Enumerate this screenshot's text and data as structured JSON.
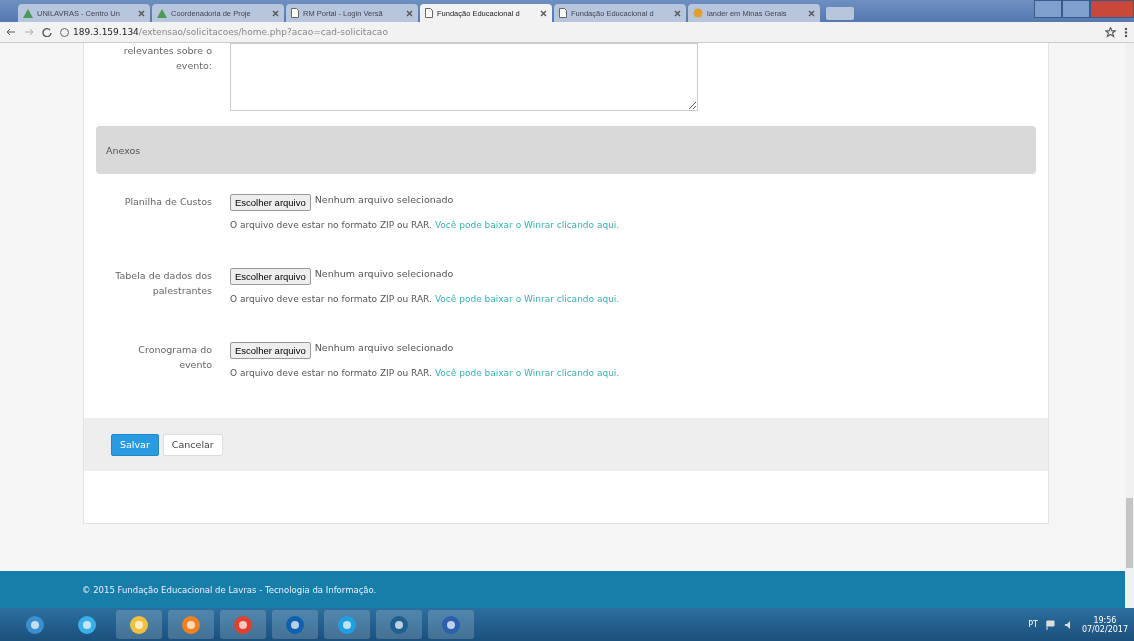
{
  "browser": {
    "tabs": [
      {
        "label": "UNILAVRAS - Centro Un",
        "selected": false
      },
      {
        "label": "Coordenadoria de Proje",
        "selected": false
      },
      {
        "label": "RM Portal - Login Versã",
        "selected": false
      },
      {
        "label": "Fundação Educacional d",
        "selected": true
      },
      {
        "label": "Fundação Educacional d",
        "selected": false
      },
      {
        "label": "lander em Minas Gerais",
        "selected": false
      }
    ],
    "address": {
      "host": "189.3.159.134",
      "path": "/extensao/solicitacoes/home.php?acao=cad-solicitacao"
    }
  },
  "form": {
    "textarea_label": "relevantes sobre o evento:",
    "section_title": "Anexos",
    "attachments": [
      {
        "label": "Planilha de Custos",
        "button": "Escolher arquivo",
        "status": "Nenhum arquivo selecionado",
        "hint": "O arquivo deve estar no formato ZIP ou RAR.",
        "link": "Você pode baixar o Winrar clicando aqui."
      },
      {
        "label": "Tabela de dados dos palestrantes",
        "button": "Escolher arquivo",
        "status": "Nenhum arquivo selecionado",
        "hint": "O arquivo deve estar no formato ZIP ou RAR.",
        "link": "Você pode baixar o Winrar clicando aqui."
      },
      {
        "label": "Cronograma do evento",
        "button": "Escolher arquivo",
        "status": "Nenhum arquivo selecionado",
        "hint": "O arquivo deve estar no formato ZIP ou RAR.",
        "link": "Você pode baixar o Winrar clicando aqui."
      }
    ],
    "buttons": [
      {
        "label": "Salvar",
        "kind": "primary"
      },
      {
        "label": "Cancelar",
        "kind": "default"
      }
    ]
  },
  "footer": "© 2015 Fundação Educacional de Lavras - Tecnologia da Informação.",
  "taskbar": {
    "language": "PT",
    "time": "19:56",
    "date": "07/02/2017"
  }
}
